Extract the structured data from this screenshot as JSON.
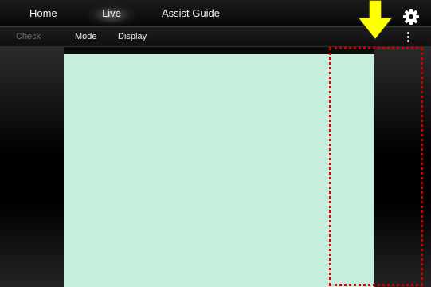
{
  "top_nav": {
    "tabs": [
      {
        "label": "Home"
      },
      {
        "label": "Live",
        "active": true
      },
      {
        "label": "Assist Guide"
      }
    ],
    "settings_icon": "gear-icon"
  },
  "toolbar": {
    "items": [
      {
        "label": "Check",
        "disabled": true
      },
      {
        "label": "Mode"
      },
      {
        "label": "Display"
      }
    ],
    "more_icon": "vertical-ellipsis-icon"
  },
  "colors": {
    "live_view_background": "#c6eedd",
    "annotation_border": "#d40000",
    "annotation_arrow": "#ffff00"
  }
}
